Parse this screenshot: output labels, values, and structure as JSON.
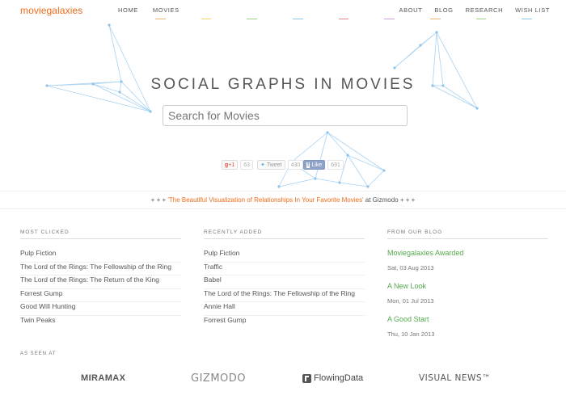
{
  "header": {
    "logo": "moviegalaxies",
    "nav_left": [
      "HOME",
      "MOVIES"
    ],
    "nav_right": [
      "ABOUT",
      "BLOG",
      "RESEARCH",
      "WISH LIST"
    ],
    "stripe_colors": [
      "#f2b36b",
      "#f5d26a",
      "#9ad27f",
      "#88c7ef",
      "#e78484",
      "#c9a3e0",
      "#f2b36b",
      "#9ad27f",
      "#88c7ef"
    ]
  },
  "hero": {
    "title": "SOCIAL GRAPHS IN MOVIES",
    "search_placeholder": "Search for Movies",
    "graph_color": "#a9d3f2"
  },
  "social": {
    "gplus_label": "+1",
    "gplus_count": "63",
    "tweet_label": "Tweet",
    "tweet_count": "430",
    "like_label": "Like",
    "like_count": "691"
  },
  "banner": {
    "prefix": "+ + + ",
    "link": "'The Beautiful Visualization of Relationships In Your Favorite Movies'",
    "suffix": " at Gizmodo + + +"
  },
  "most_clicked": {
    "heading": "MOST CLICKED",
    "items": [
      "Pulp Fiction",
      "The Lord of the Rings: The Fellowship of the Ring",
      "The Lord of the Rings: The Return of the King",
      "Forrest Gump",
      "Good Will Hunting",
      "Twin Peaks"
    ]
  },
  "recently_added": {
    "heading": "RECENTLY ADDED",
    "items": [
      "Pulp Fiction",
      "Traffic",
      "Babel",
      "The Lord of the Rings: The Fellowship of the Ring",
      "Annie Hall",
      "Forrest Gump"
    ]
  },
  "blog": {
    "heading": "FROM OUR BLOG",
    "posts": [
      {
        "title": "Moviegalaxies Awarded",
        "date": "Sat, 03 Aug 2013"
      },
      {
        "title": "A New Look",
        "date": "Mon, 01 Jul 2013"
      },
      {
        "title": "A Good Start",
        "date": "Thu, 10 Jan 2013"
      }
    ]
  },
  "seen_at": {
    "label": "AS SEEN AT",
    "brands": [
      "MIRAMAX",
      "GIZMODO",
      "FlowingData",
      "VISUAL NEWS™"
    ]
  }
}
